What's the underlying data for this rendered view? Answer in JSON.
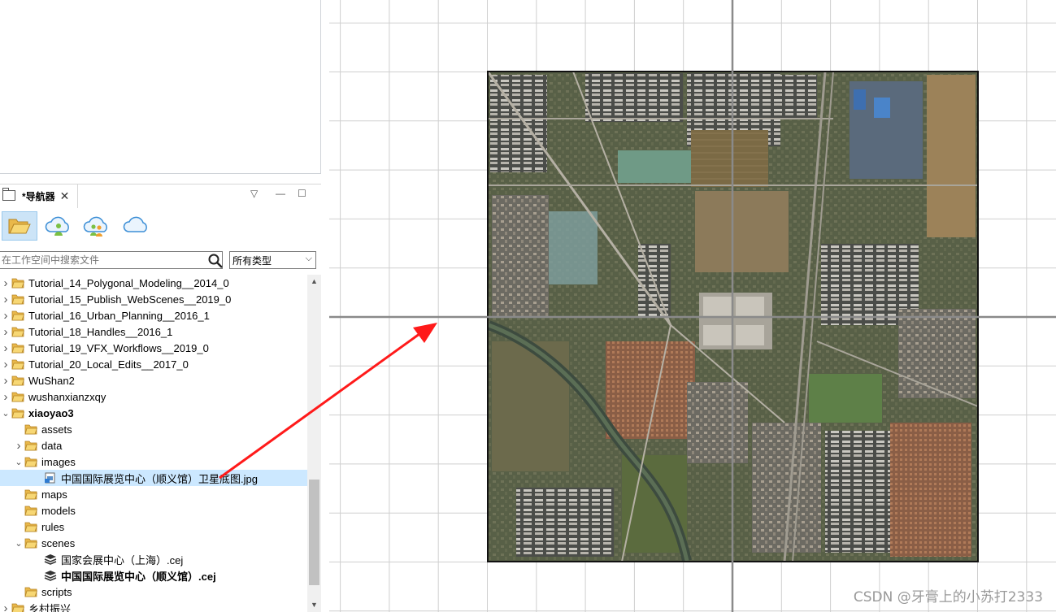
{
  "navigator": {
    "tab_title": "*导航器",
    "search_placeholder": "在工作空间中搜索文件",
    "type_filter": "所有类型",
    "tree": [
      {
        "label": "Tutorial_14_Polygonal_Modeling__2014_0",
        "kind": "project",
        "twisty": "collapsed",
        "indent": 0
      },
      {
        "label": "Tutorial_15_Publish_WebScenes__2019_0",
        "kind": "project",
        "twisty": "collapsed",
        "indent": 0
      },
      {
        "label": "Tutorial_16_Urban_Planning__2016_1",
        "kind": "project",
        "twisty": "collapsed",
        "indent": 0
      },
      {
        "label": "Tutorial_18_Handles__2016_1",
        "kind": "project",
        "twisty": "collapsed",
        "indent": 0
      },
      {
        "label": "Tutorial_19_VFX_Workflows__2019_0",
        "kind": "project",
        "twisty": "collapsed",
        "indent": 0
      },
      {
        "label": "Tutorial_20_Local_Edits__2017_0",
        "kind": "project",
        "twisty": "collapsed",
        "indent": 0
      },
      {
        "label": "WuShan2",
        "kind": "project",
        "twisty": "collapsed",
        "indent": 0
      },
      {
        "label": "wushanxianzxqy",
        "kind": "project",
        "twisty": "collapsed",
        "indent": 0
      },
      {
        "label": "xiaoyao3",
        "kind": "project",
        "twisty": "expanded",
        "indent": 0,
        "bold": true
      },
      {
        "label": "assets",
        "kind": "folder",
        "twisty": "none",
        "indent": 1
      },
      {
        "label": "data",
        "kind": "folder",
        "twisty": "collapsed",
        "indent": 1
      },
      {
        "label": "images",
        "kind": "folder",
        "twisty": "expanded",
        "indent": 1
      },
      {
        "label": "中国国际展览中心（顺义馆）卫星底图.jpg",
        "kind": "image",
        "twisty": "none",
        "indent": 2,
        "selected": true
      },
      {
        "label": "maps",
        "kind": "folder",
        "twisty": "none",
        "indent": 1
      },
      {
        "label": "models",
        "kind": "folder",
        "twisty": "none",
        "indent": 1
      },
      {
        "label": "rules",
        "kind": "folder",
        "twisty": "none",
        "indent": 1
      },
      {
        "label": "scenes",
        "kind": "folder",
        "twisty": "expanded",
        "indent": 1
      },
      {
        "label": "国家会展中心（上海）.cej",
        "kind": "scene",
        "twisty": "none",
        "indent": 2
      },
      {
        "label": "中国国际展览中心（顺义馆）.cej",
        "kind": "scene",
        "twisty": "none",
        "indent": 2,
        "bold": true
      },
      {
        "label": "scripts",
        "kind": "folder",
        "twisty": "none",
        "indent": 1
      },
      {
        "label": "乡村振兴",
        "kind": "project",
        "twisty": "collapsed",
        "indent": 0
      }
    ]
  },
  "toolbar_icons": [
    "folder-open-icon",
    "cloud-user-icon",
    "cloud-users-icon",
    "cloud-icon"
  ],
  "viewport": {
    "grid_color": "#cfcfcf",
    "axis_color": "#8a8a8a",
    "arrow_color": "#ff1a1a"
  },
  "watermark": "CSDN @牙膏上的小苏打2333"
}
